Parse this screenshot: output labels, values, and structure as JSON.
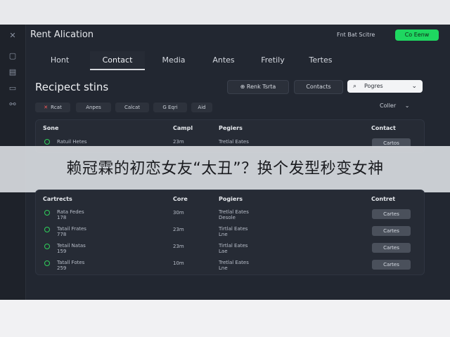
{
  "app": {
    "title": "Rent Alication"
  },
  "header": {
    "link": "Fnt Bat Scitre",
    "button": "Co Eenw"
  },
  "tabs": [
    {
      "label": "Hont",
      "active": false
    },
    {
      "label": "Contact",
      "active": true
    },
    {
      "label": "Media",
      "active": false
    },
    {
      "label": "Antes",
      "active": false
    },
    {
      "label": "Fretily",
      "active": false
    },
    {
      "label": "Tertes",
      "active": false
    }
  ],
  "page": {
    "title": "Recipect stins"
  },
  "actions": {
    "rent_btn": "Renk Tsrta",
    "contacts_btn": "Contacts",
    "search_value": "Pogres"
  },
  "filters": {
    "chips": [
      "Rcat",
      "Anpes",
      "Calcat",
      "G Eqri",
      "Aid"
    ],
    "sort_label": "Coller"
  },
  "table1": {
    "headers": {
      "name": "Sone",
      "comp": "Campl",
      "pages": "Pegiers",
      "contact": "Contact"
    },
    "rows": [
      {
        "name": "Ratuil Hetes",
        "comp": "23m",
        "pages": "Tretlal Eates",
        "action": "Cartos"
      },
      {
        "name": "Datail Hates",
        "comp": "23m",
        "pages": "Tretlal Eates",
        "action": "Cartes"
      }
    ]
  },
  "caption": "赖冠霖的初恋女友“太丑”？换个发型秒变女神",
  "table2": {
    "headers": {
      "name": "Cartrects",
      "comp": "Core",
      "pages": "Pogiers",
      "contact": "Contret"
    },
    "rows": [
      {
        "name1": "Rata Fedes",
        "name2": "178",
        "comp": "30m",
        "pages1": "Tretlal Eates",
        "pages2": "Desole",
        "action": "Cartes"
      },
      {
        "name1": "Tatail Frates",
        "name2": "778",
        "comp": "23m",
        "pages1": "Tirtlal Eates",
        "pages2": "Lne",
        "action": "Cartes"
      },
      {
        "name1": "Tetail Natas",
        "name2": "159",
        "comp": "23m",
        "pages1": "Tirtlal Eates",
        "pages2": "Lae",
        "action": "Cartes"
      },
      {
        "name1": "Tatall Fotes",
        "name2": "259",
        "comp": "10m",
        "pages1": "Tretlal Eates",
        "pages2": "Lne",
        "action": "Cartes"
      }
    ]
  },
  "icons": [
    "grid-icon",
    "window-icon",
    "lock-icon",
    "card-icon",
    "share-icon",
    "search-icon",
    "chevron-down-icon"
  ]
}
